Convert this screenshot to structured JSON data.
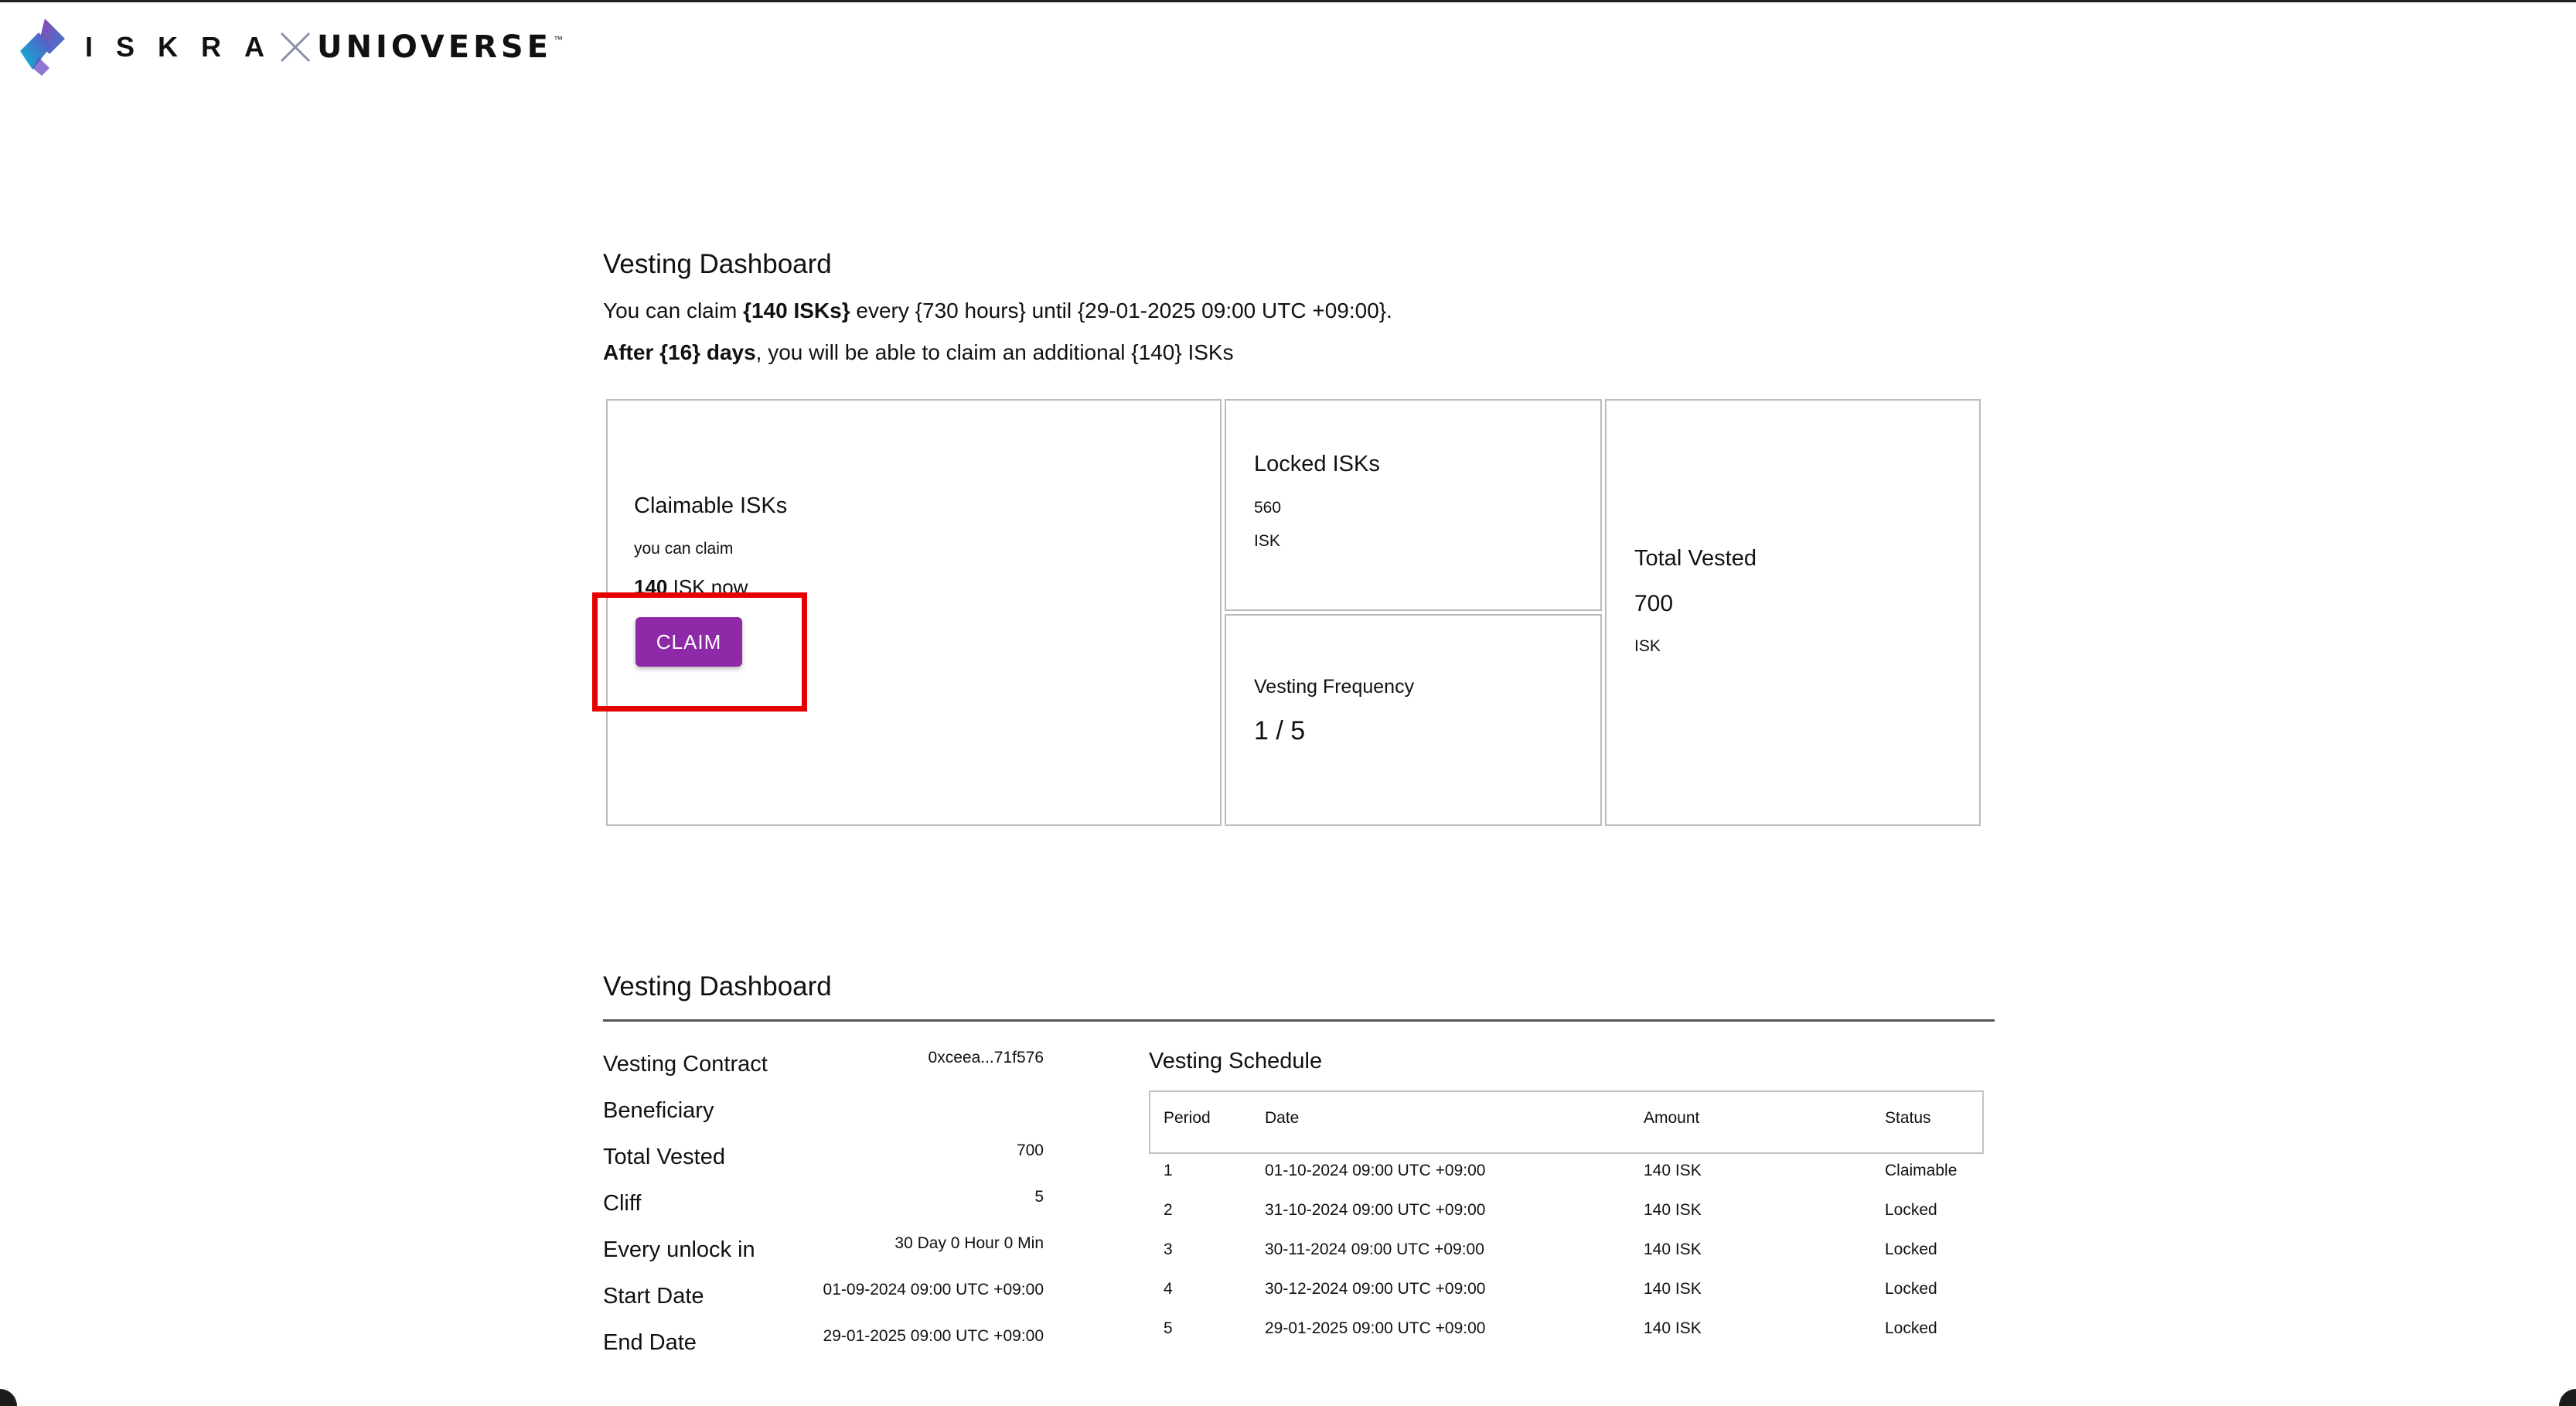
{
  "header": {
    "brand": "ISKRA",
    "partner": "UNIOVERSE",
    "trademark": "™",
    "brand_colors": [
      "#3a7bd5",
      "#6a4bc4",
      "#00bcd4",
      "#8e44ad"
    ]
  },
  "summary": {
    "title": "Vesting Dashboard",
    "line1": {
      "prefix": "You can claim ",
      "amount": "{140 ISKs}",
      "mid": " every {730 hours} until {29-01-2025 09:00 UTC +09:00}."
    },
    "line2": {
      "bold": "After {16} days",
      "rest": ", you will be able to claim an additional {140} ISKs"
    }
  },
  "cards": {
    "claimable": {
      "title": "Claimable ISKs",
      "subtitle": "you can claim",
      "amount": "140",
      "suffix": " ISK now",
      "button_label": "CLAIM",
      "button_color": "#8e2aa8"
    },
    "locked": {
      "title": "Locked ISKs",
      "value": "560",
      "unit": "ISK"
    },
    "frequency": {
      "title": "Vesting Frequency",
      "value": "1 / 5"
    },
    "total": {
      "title": "Total Vested",
      "value": "700",
      "unit": "ISK"
    }
  },
  "annotation": {
    "highlight_color": "#e60000"
  },
  "details": {
    "title": "Vesting Dashboard",
    "rows": [
      {
        "label": "Vesting Contract",
        "value": "0xceea...71f576"
      },
      {
        "label": "Beneficiary",
        "value": ""
      },
      {
        "label": "Total Vested",
        "value": "700"
      },
      {
        "label": "Cliff",
        "value": "5"
      },
      {
        "label": "Every unlock in",
        "value": "30 Day 0 Hour 0 Min"
      },
      {
        "label": "Start Date",
        "value": "01-09-2024 09:00 UTC +09:00"
      },
      {
        "label": "End Date",
        "value": "29-01-2025 09:00 UTC +09:00"
      }
    ]
  },
  "schedule": {
    "title": "Vesting Schedule",
    "columns": [
      "Period",
      "Date",
      "Amount",
      "Status"
    ],
    "rows": [
      [
        "1",
        "01-10-2024 09:00 UTC +09:00",
        "140 ISK",
        "Claimable"
      ],
      [
        "2",
        "31-10-2024 09:00 UTC +09:00",
        "140 ISK",
        "Locked"
      ],
      [
        "3",
        "30-11-2024 09:00 UTC +09:00",
        "140 ISK",
        "Locked"
      ],
      [
        "4",
        "30-12-2024 09:00 UTC +09:00",
        "140 ISK",
        "Locked"
      ],
      [
        "5",
        "29-01-2025 09:00 UTC +09:00",
        "140 ISK",
        "Locked"
      ]
    ]
  }
}
